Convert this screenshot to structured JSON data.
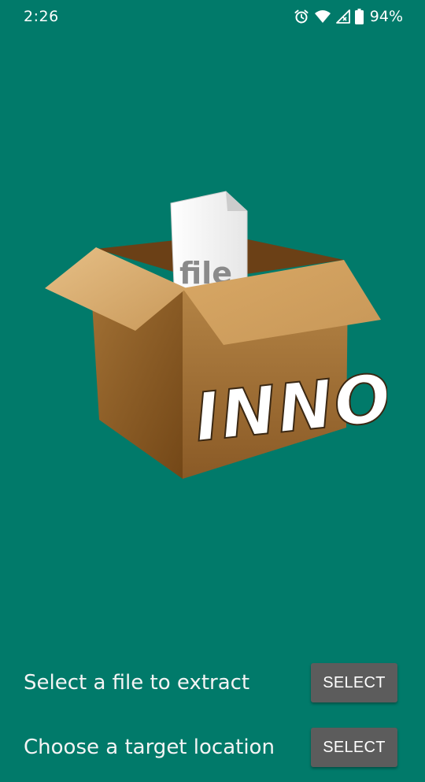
{
  "status_bar": {
    "time": "2:26",
    "battery": "94%",
    "icons": [
      "alarm-icon",
      "wifi-icon",
      "cell-signal-icon",
      "battery-icon"
    ]
  },
  "logo": {
    "name": "inno-box-logo",
    "box_text": "INNO",
    "paper_text": "file"
  },
  "actions": [
    {
      "label": "Select a file to extract",
      "button": "SELECT"
    },
    {
      "label": "Choose a target location",
      "button": "SELECT"
    }
  ],
  "colors": {
    "background": "#017A6A",
    "button": "#5C5C5C",
    "text": "#FFFFFF"
  }
}
